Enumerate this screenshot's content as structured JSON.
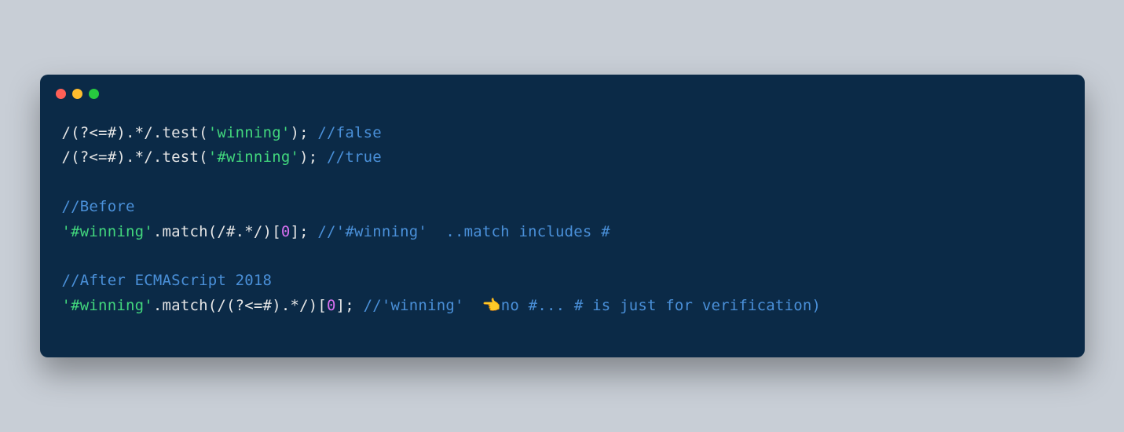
{
  "code": {
    "lines": [
      {
        "tokens": [
          {
            "text": "/(?<=#).*/.test(",
            "cls": "c-white"
          },
          {
            "text": "'winning'",
            "cls": "c-green"
          },
          {
            "text": "); ",
            "cls": "c-white"
          },
          {
            "text": "//false",
            "cls": "c-comment"
          }
        ]
      },
      {
        "tokens": [
          {
            "text": "/(?<=#).*/.test(",
            "cls": "c-white"
          },
          {
            "text": "'#winning'",
            "cls": "c-green"
          },
          {
            "text": "); ",
            "cls": "c-white"
          },
          {
            "text": "//true",
            "cls": "c-comment"
          }
        ]
      },
      {
        "tokens": [
          {
            "text": " ",
            "cls": "c-white"
          }
        ]
      },
      {
        "tokens": [
          {
            "text": "//Before",
            "cls": "c-comment"
          }
        ]
      },
      {
        "tokens": [
          {
            "text": "'#winning'",
            "cls": "c-green"
          },
          {
            "text": ".match(/#.*/)[",
            "cls": "c-white"
          },
          {
            "text": "0",
            "cls": "c-purple"
          },
          {
            "text": "]; ",
            "cls": "c-white"
          },
          {
            "text": "//'#winning'  ..match includes #",
            "cls": "c-comment"
          }
        ]
      },
      {
        "tokens": [
          {
            "text": " ",
            "cls": "c-white"
          }
        ]
      },
      {
        "tokens": [
          {
            "text": "//After ECMAScript 2018",
            "cls": "c-comment"
          }
        ]
      },
      {
        "tokens": [
          {
            "text": "'#winning'",
            "cls": "c-green"
          },
          {
            "text": ".match(/(?<=#).*/)[",
            "cls": "c-white"
          },
          {
            "text": "0",
            "cls": "c-purple"
          },
          {
            "text": "]; ",
            "cls": "c-white"
          },
          {
            "text": "//'winning'  👈no #... # is just for verification)",
            "cls": "c-comment"
          }
        ]
      }
    ]
  }
}
